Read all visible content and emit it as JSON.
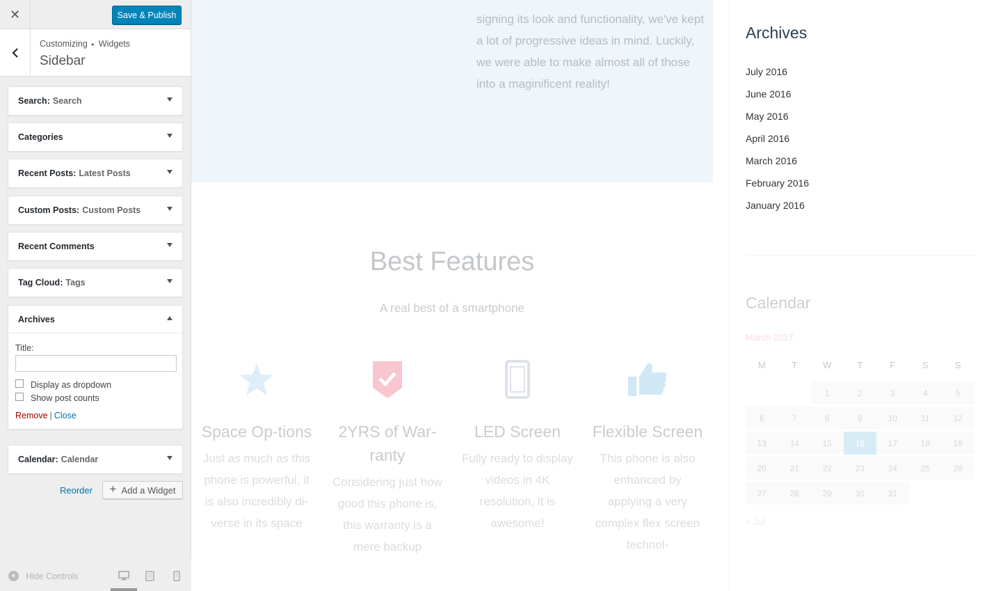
{
  "customizer": {
    "close_icon": "✕",
    "save_label": "Save & Publish",
    "breadcrumb": {
      "root": "Customizing",
      "separator": "▸",
      "current": "Widgets"
    },
    "section_title": "Sidebar",
    "widgets": [
      {
        "name": "Search",
        "subtitle": "Search"
      },
      {
        "name": "Categories",
        "subtitle": ""
      },
      {
        "name": "Recent Posts",
        "subtitle": "Latest Posts"
      },
      {
        "name": "Custom Posts",
        "subtitle": "Custom Posts"
      },
      {
        "name": "Recent Comments",
        "subtitle": ""
      },
      {
        "name": "Tag Cloud",
        "subtitle": "Tags"
      },
      {
        "name": "Archives",
        "subtitle": ""
      },
      {
        "name": "Calendar",
        "subtitle": "Calendar"
      }
    ],
    "archives_form": {
      "title_label": "Title:",
      "title_value": "",
      "dropdown_label": "Display as dropdown",
      "dropdown_checked": false,
      "counts_label": "Show post counts",
      "counts_checked": false,
      "remove_label": "Remove",
      "pipe": "|",
      "close_label": "Close"
    },
    "reorder_label": "Reorder",
    "add_widget_label": "Add a Widget",
    "hide_controls_label": "Hide Controls",
    "devices": [
      "desktop-icon",
      "tablet-icon",
      "mobile-icon"
    ],
    "active_device": "desktop",
    "colors": {
      "primary": "#0085ba",
      "link": "#0073aa",
      "remove": "#aa0000"
    }
  },
  "preview": {
    "hero_text": "signing its look and functionality, we've kept a lot of progressive ideas in mind. Luckily, we were able to make almost all of those into a maginificent reality!",
    "features_title": "Best Features",
    "features_subtitle": "A real best of a smartphone",
    "features": [
      {
        "icon": "star-icon",
        "color": "#ddeef8",
        "title": "Space Op-tions",
        "desc": "Just as much as this phone is powerful, it is also incredibly di-verse in its space"
      },
      {
        "icon": "shield-check-icon",
        "color": "#f7c6cf",
        "title": "2YRS of War-ranty",
        "desc": "Considering just how good this phone is, this warranty is a mere backup"
      },
      {
        "icon": "phone-icon",
        "color": "#dde2ea",
        "title": "LED Screen",
        "desc": "Fully ready to display videos in 4K resolution, it is awesome!"
      },
      {
        "icon": "thumbs-up-icon",
        "color": "#d0e8f5",
        "title": "Flexible Screen",
        "desc": "This phone is also enhanced by applying a very complex flex screen technol-"
      }
    ],
    "sidebar": {
      "archives_title": "Archives",
      "archives": [
        "July 2016",
        "June 2016",
        "May 2016",
        "April 2016",
        "March 2016",
        "February 2016",
        "January 2016"
      ],
      "calendar_title": "Calendar",
      "calendar_month": "March 2017",
      "weekdays": [
        "M",
        "T",
        "W",
        "T",
        "F",
        "S",
        "S"
      ],
      "weeks": [
        [
          "",
          "",
          "1",
          "2",
          "3",
          "4",
          "5"
        ],
        [
          "6",
          "7",
          "8",
          "9",
          "10",
          "11",
          "12"
        ],
        [
          "13",
          "14",
          "15",
          "16",
          "17",
          "18",
          "19"
        ],
        [
          "20",
          "21",
          "22",
          "23",
          "24",
          "25",
          "26"
        ],
        [
          "27",
          "28",
          "29",
          "30",
          "31",
          "",
          ""
        ]
      ],
      "today": "16",
      "prev_link": "« Jul"
    }
  }
}
